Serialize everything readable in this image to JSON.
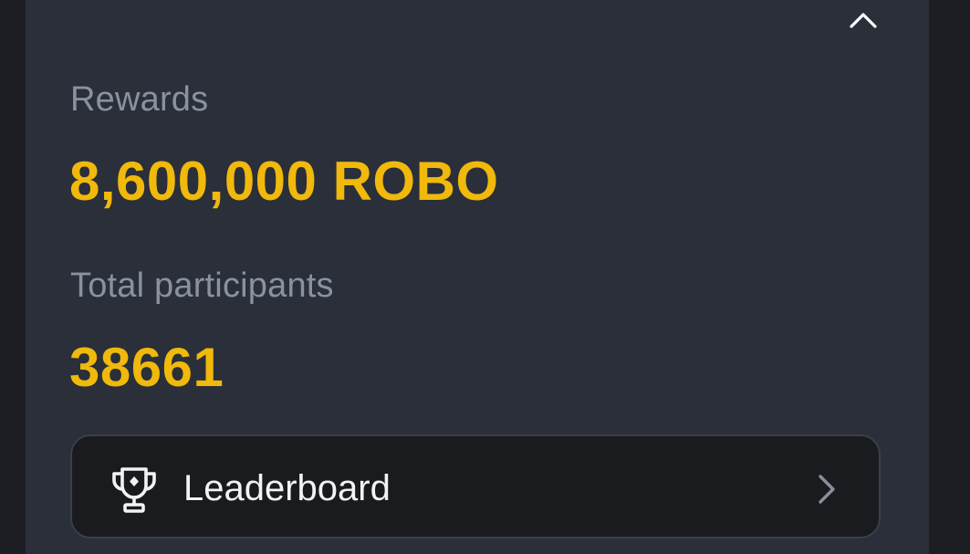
{
  "rewards": {
    "label": "Rewards",
    "value": "8,600,000 ROBO"
  },
  "participants": {
    "label": "Total participants",
    "value": "38661"
  },
  "leaderboard": {
    "label": "Leaderboard",
    "icon": "trophy-icon",
    "chevron": "chevron-right-icon"
  },
  "header": {
    "collapse_icon": "chevron-up-icon"
  },
  "colors": {
    "accent": "#f0b90b",
    "panel": "#2a2f39",
    "background": "#1c1e23",
    "muted_text": "#8a929f"
  }
}
